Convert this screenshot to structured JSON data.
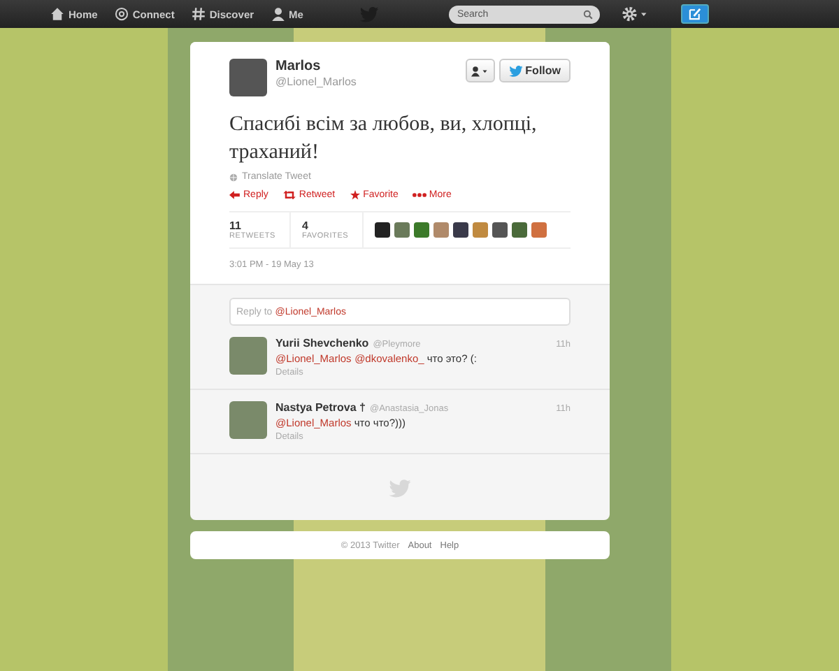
{
  "nav": {
    "items": [
      {
        "label": "Home",
        "kind": "home"
      },
      {
        "label": "Connect",
        "kind": "connect"
      },
      {
        "label": "Discover",
        "kind": "discover"
      },
      {
        "label": "Me",
        "kind": "me"
      }
    ],
    "search": {
      "placeholder": "Search"
    }
  },
  "tweet": {
    "name": "Marlos",
    "handle": "@Lionel_Marlos",
    "follow": "Follow",
    "text": "Спасибі всім за любов, ви, хлопці, траханий!",
    "translate": "Translate Tweet",
    "actions": [
      {
        "label": "Reply",
        "kind": "reply"
      },
      {
        "label": "Retweet",
        "kind": "retweet"
      },
      {
        "label": "Favorite",
        "kind": "favorite"
      },
      {
        "label": "More",
        "kind": "more"
      }
    ],
    "stats": [
      {
        "count": "11",
        "label": "RETWEETS"
      },
      {
        "count": "4",
        "label": "FAVORITES"
      }
    ],
    "time": "3:01 PM - 19 May 13"
  },
  "reply_box": {
    "placeholder": "Reply to",
    "mention": "@Lionel_Marlos"
  },
  "replies": [
    {
      "name": "Yurii Shevchenko",
      "handle": "@Pleymore",
      "time": "11h",
      "parts": [
        {
          "kind": "mention",
          "text": "@Lionel_Marlos"
        },
        {
          "kind": "mention",
          "text": "@dkovalenko_"
        },
        {
          "kind": "text",
          "text": " что это? (:"
        }
      ],
      "details": "Details"
    },
    {
      "name": "Nastya Petrova †",
      "handle": "@Anastasia_Jonas",
      "time": "11h",
      "parts": [
        {
          "kind": "mention",
          "text": "@Lionel_Marlos"
        },
        {
          "kind": "text",
          "text": " что что?)))"
        }
      ],
      "details": "Details"
    }
  ],
  "footer": [
    {
      "text": "© 2013 Twitter",
      "kind": "text"
    },
    {
      "text": "About",
      "kind": "link"
    },
    {
      "text": "Help",
      "kind": "link"
    }
  ]
}
